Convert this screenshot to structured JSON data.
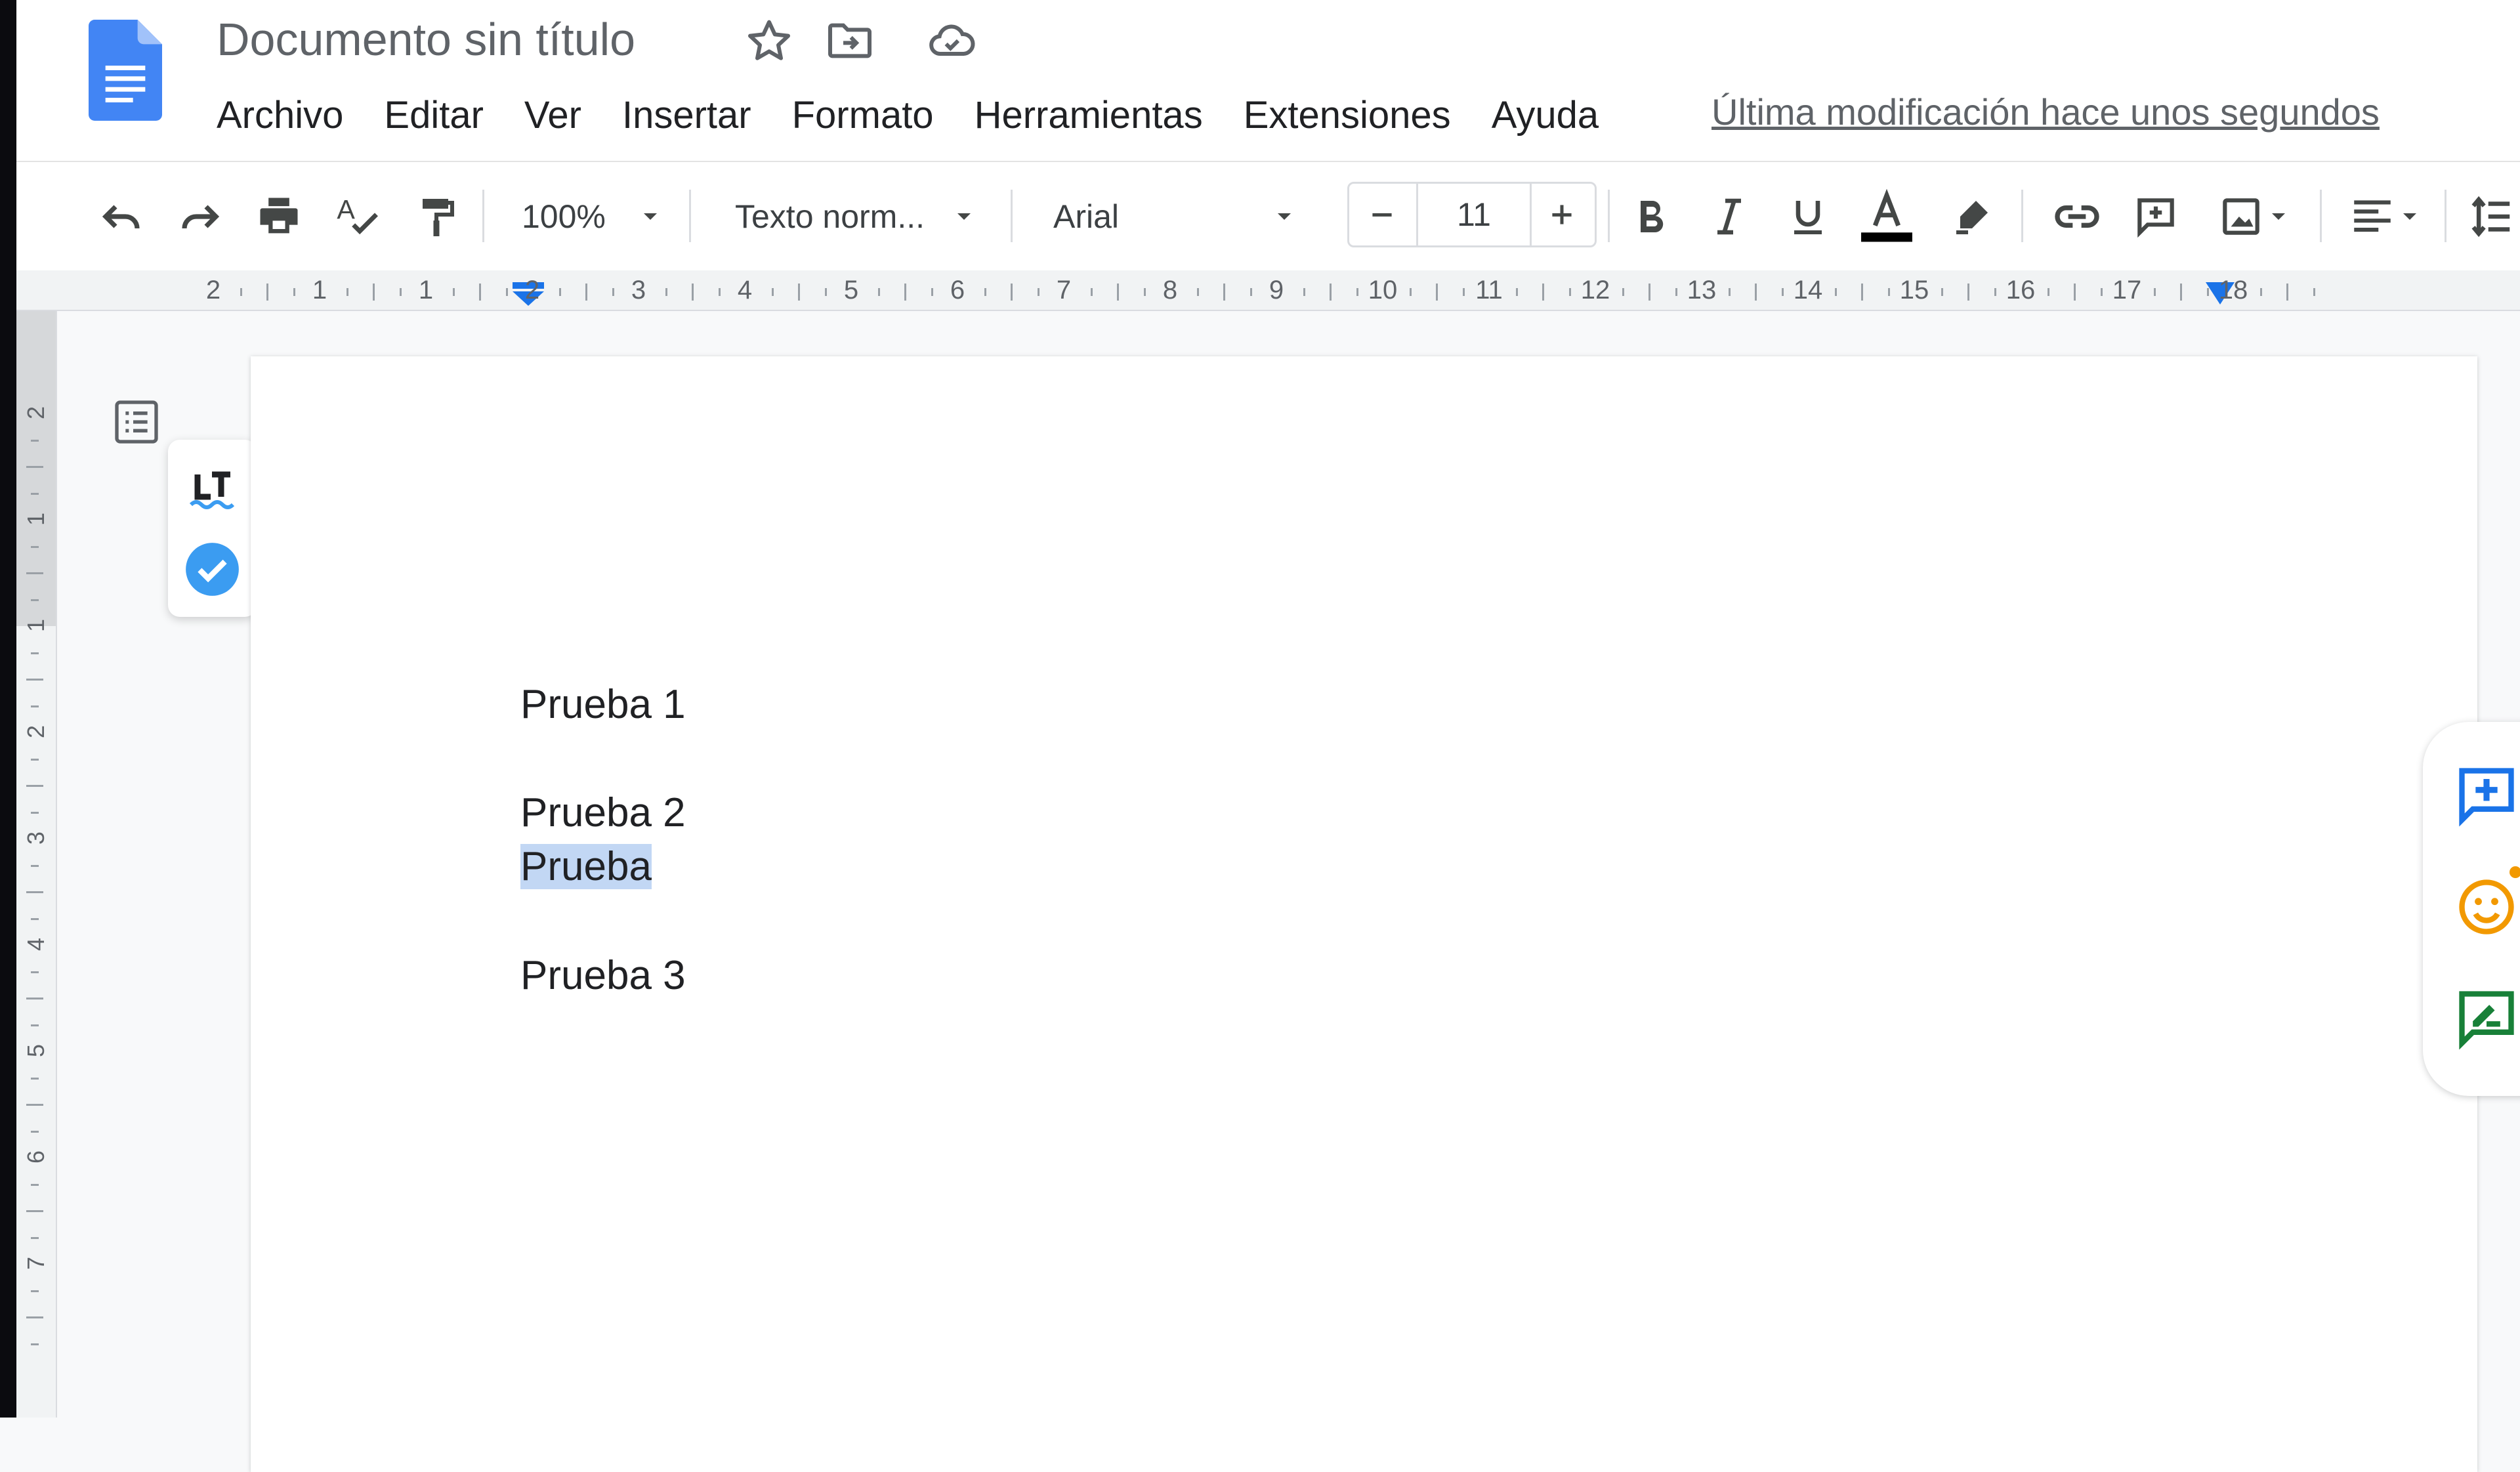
{
  "document": {
    "title": "Documento sin título",
    "last_modified": "Última modificación hace unos segundos"
  },
  "menu": [
    "Archivo",
    "Editar",
    "Ver",
    "Insertar",
    "Formato",
    "Herramientas",
    "Extensiones",
    "Ayuda"
  ],
  "toolbar": {
    "zoom": "100%",
    "style": "Texto norm...",
    "font": "Arial",
    "font_size": "11"
  },
  "ruler": {
    "horizontal_numbers": [
      "2",
      "1",
      "1",
      "2",
      "3",
      "4",
      "5",
      "6",
      "7",
      "8",
      "9",
      "10",
      "11",
      "12",
      "13",
      "14",
      "15",
      "16",
      "17",
      "18"
    ],
    "vertical_numbers": [
      "2",
      "1",
      "1",
      "2",
      "3",
      "4",
      "5",
      "6",
      "7"
    ]
  },
  "content": {
    "lines": [
      "Prueba 1",
      "Prueba 2",
      "Prueba",
      "Prueba 3"
    ],
    "selected_line": "Prueba"
  },
  "colors": {
    "brand_blue": "#4285f4",
    "selection": "#c2d7f4",
    "text_color_swatch": "#000000",
    "side_add_comment": "#1a73e8",
    "side_emoji": "#f29900",
    "side_suggest": "#188038",
    "languagetool_check": "#3b9cf1"
  }
}
